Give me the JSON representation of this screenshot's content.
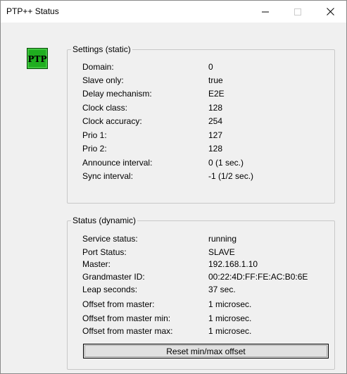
{
  "window": {
    "title": "PTP++ Status"
  },
  "logo": {
    "text": "PTP",
    "color": "#1fae1f"
  },
  "settings": {
    "legend": "Settings (static)",
    "rows": [
      {
        "label": "Domain:",
        "value": "0"
      },
      {
        "label": "Slave only:",
        "value": "true"
      },
      {
        "label": "Delay mechanism:",
        "value": "E2E"
      },
      {
        "label": "Clock class:",
        "value": "128"
      },
      {
        "label": "Clock accuracy:",
        "value": "254"
      },
      {
        "label": "Prio 1:",
        "value": "127"
      },
      {
        "label": "Prio 2:",
        "value": "128"
      },
      {
        "label": "Announce interval:",
        "value": "0 (1 sec.)"
      },
      {
        "label": "Sync interval:",
        "value": "-1 (1/2 sec.)"
      }
    ]
  },
  "status": {
    "legend": "Status (dynamic)",
    "rows": [
      {
        "label": "Service status:",
        "value": "running"
      },
      {
        "label": "Port Status:",
        "value": "SLAVE"
      },
      {
        "label": "Master:",
        "value": "192.168.1.10"
      },
      {
        "label": "Grandmaster ID:",
        "value": "00:22:4D:FF:FE:AC:B0:6E"
      },
      {
        "label": "Leap seconds:",
        "value": "37 sec."
      },
      {
        "label": "Offset from master:",
        "value": "1 microsec."
      },
      {
        "label": "Offset from master min:",
        "value": "1 microsec."
      },
      {
        "label": "Offset from master max:",
        "value": "1 microsec."
      }
    ],
    "reset_label": "Reset min/max offset"
  }
}
